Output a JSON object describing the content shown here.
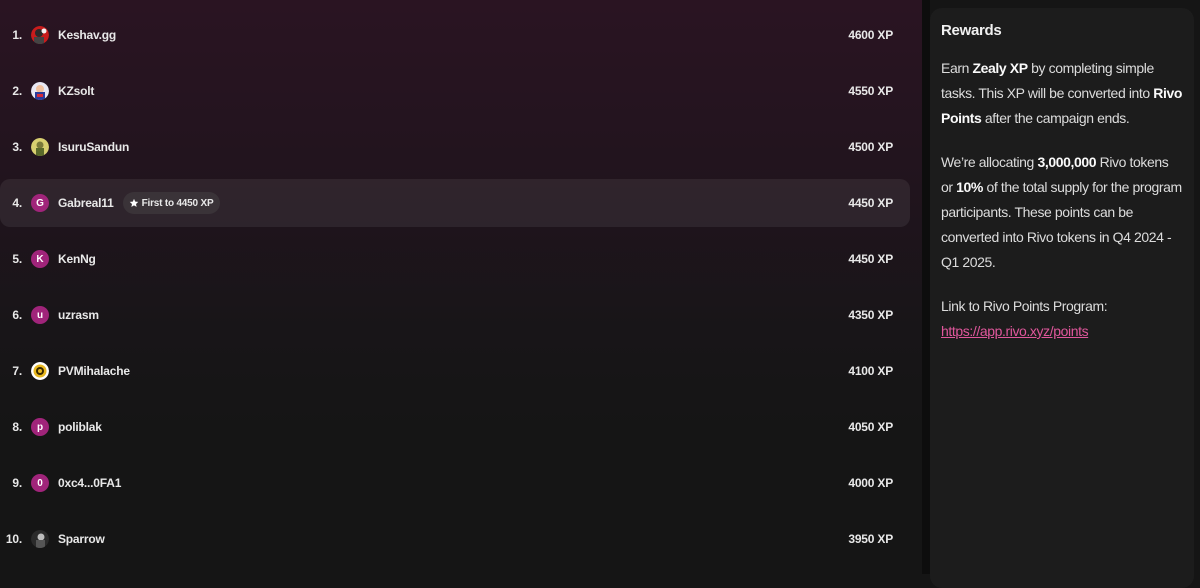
{
  "leaderboard": {
    "rows": [
      {
        "rank": "1.",
        "name": "Keshav.gg",
        "xp": "4600 XP",
        "avatar": {
          "type": "image",
          "icon": "red-avatar-icon"
        }
      },
      {
        "rank": "2.",
        "name": "KZsolt",
        "xp": "4550 XP",
        "avatar": {
          "type": "image",
          "icon": "blue-character-avatar-icon"
        }
      },
      {
        "rank": "3.",
        "name": "IsuruSandun",
        "xp": "4500 XP",
        "avatar": {
          "type": "image",
          "icon": "yellow-character-avatar-icon"
        }
      },
      {
        "rank": "4.",
        "name": "Gabreal11",
        "xp": "4450 XP",
        "avatar": {
          "type": "letter",
          "letter": "G"
        },
        "badge": "First to 4450 XP",
        "highlight": true
      },
      {
        "rank": "5.",
        "name": "KenNg",
        "xp": "4450 XP",
        "avatar": {
          "type": "letter",
          "letter": "K"
        }
      },
      {
        "rank": "6.",
        "name": "uzrasm",
        "xp": "4350 XP",
        "avatar": {
          "type": "letter",
          "letter": "u"
        }
      },
      {
        "rank": "7.",
        "name": "PVMihalache",
        "xp": "4100 XP",
        "avatar": {
          "type": "image",
          "icon": "yellow-logo-avatar-icon"
        }
      },
      {
        "rank": "8.",
        "name": "poliblak",
        "xp": "4050 XP",
        "avatar": {
          "type": "letter",
          "letter": "p"
        }
      },
      {
        "rank": "9.",
        "name": "0xc4...0FA1",
        "xp": "4000 XP",
        "avatar": {
          "type": "letter",
          "letter": "0"
        }
      },
      {
        "rank": "10.",
        "name": "Sparrow",
        "xp": "3950 XP",
        "avatar": {
          "type": "image",
          "icon": "dark-character-avatar-icon"
        }
      }
    ],
    "badge_icon": "star-icon"
  },
  "rewards": {
    "title": "Rewards",
    "p1": {
      "a": "Earn ",
      "b": "Zealy XP",
      "c": " by completing simple tasks. This XP will be converted into ",
      "d": "Rivo Points",
      "e": " after the campaign ends."
    },
    "p2": {
      "a": "We’re allocating ",
      "b": "3,000,000",
      "c": " Rivo tokens or ",
      "d": "10%",
      "e": " of the total supply for the program participants. These points can be converted into Rivo tokens in Q4 2024 - Q1 2025."
    },
    "p3": {
      "a": " Link to Rivo Points Program:",
      "link": "https://app.rivo.xyz/points"
    }
  },
  "colors": {
    "accent": "#a0247a",
    "link": "#e0579c",
    "panel": "#1c1c1c"
  }
}
